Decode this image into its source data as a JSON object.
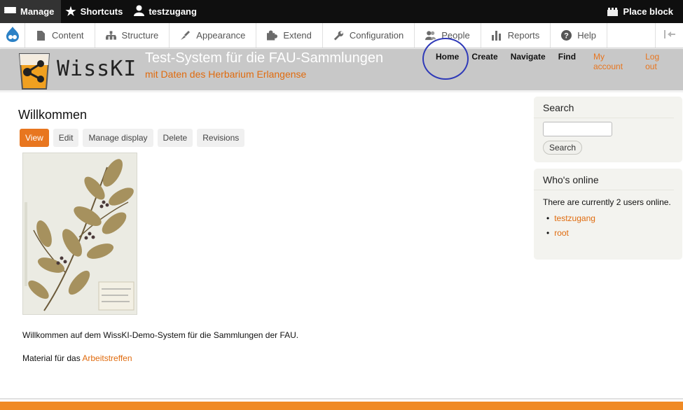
{
  "admin_bar": {
    "manage": "Manage",
    "shortcuts": "Shortcuts",
    "user": "testzugang",
    "place_block": "Place block"
  },
  "tray": {
    "items": [
      {
        "label": "Content",
        "icon": "page-icon"
      },
      {
        "label": "Structure",
        "icon": "sitemap-icon"
      },
      {
        "label": "Appearance",
        "icon": "brush-icon"
      },
      {
        "label": "Extend",
        "icon": "puzzle-icon"
      },
      {
        "label": "Configuration",
        "icon": "wrench-icon"
      },
      {
        "label": "People",
        "icon": "people-icon"
      },
      {
        "label": "Reports",
        "icon": "bar-chart-icon"
      },
      {
        "label": "Help",
        "icon": "help-icon"
      }
    ]
  },
  "header": {
    "logo_text": "WissKI",
    "site_name": "Test-System für die FAU-Sammlungen",
    "slogan": "mit Daten des Herbarium Erlangense",
    "main_menu": [
      "Home",
      "Create",
      "Navigate",
      "Find"
    ],
    "user_menu": [
      "My account",
      "Log out"
    ]
  },
  "page": {
    "title": "Willkommen",
    "tabs": [
      "View",
      "Edit",
      "Manage display",
      "Delete",
      "Revisions"
    ],
    "active_tab": "View",
    "paragraph1": "Willkommen auf dem WissKI-Demo-System für die Sammlungen der FAU.",
    "paragraph2_prefix": "Material für das ",
    "paragraph2_link": "Arbeitstreffen"
  },
  "sidebar": {
    "search": {
      "title": "Search",
      "button": "Search"
    },
    "whos_online": {
      "title": "Who's online",
      "text": "There are currently 2 users online.",
      "users": [
        "testzugang",
        "root"
      ]
    }
  },
  "colors": {
    "accent": "#e8761f",
    "admin_bar": "#0f0f0f",
    "header_bg": "#c8c8c8",
    "annotation_circle": "#2f3ab8"
  }
}
